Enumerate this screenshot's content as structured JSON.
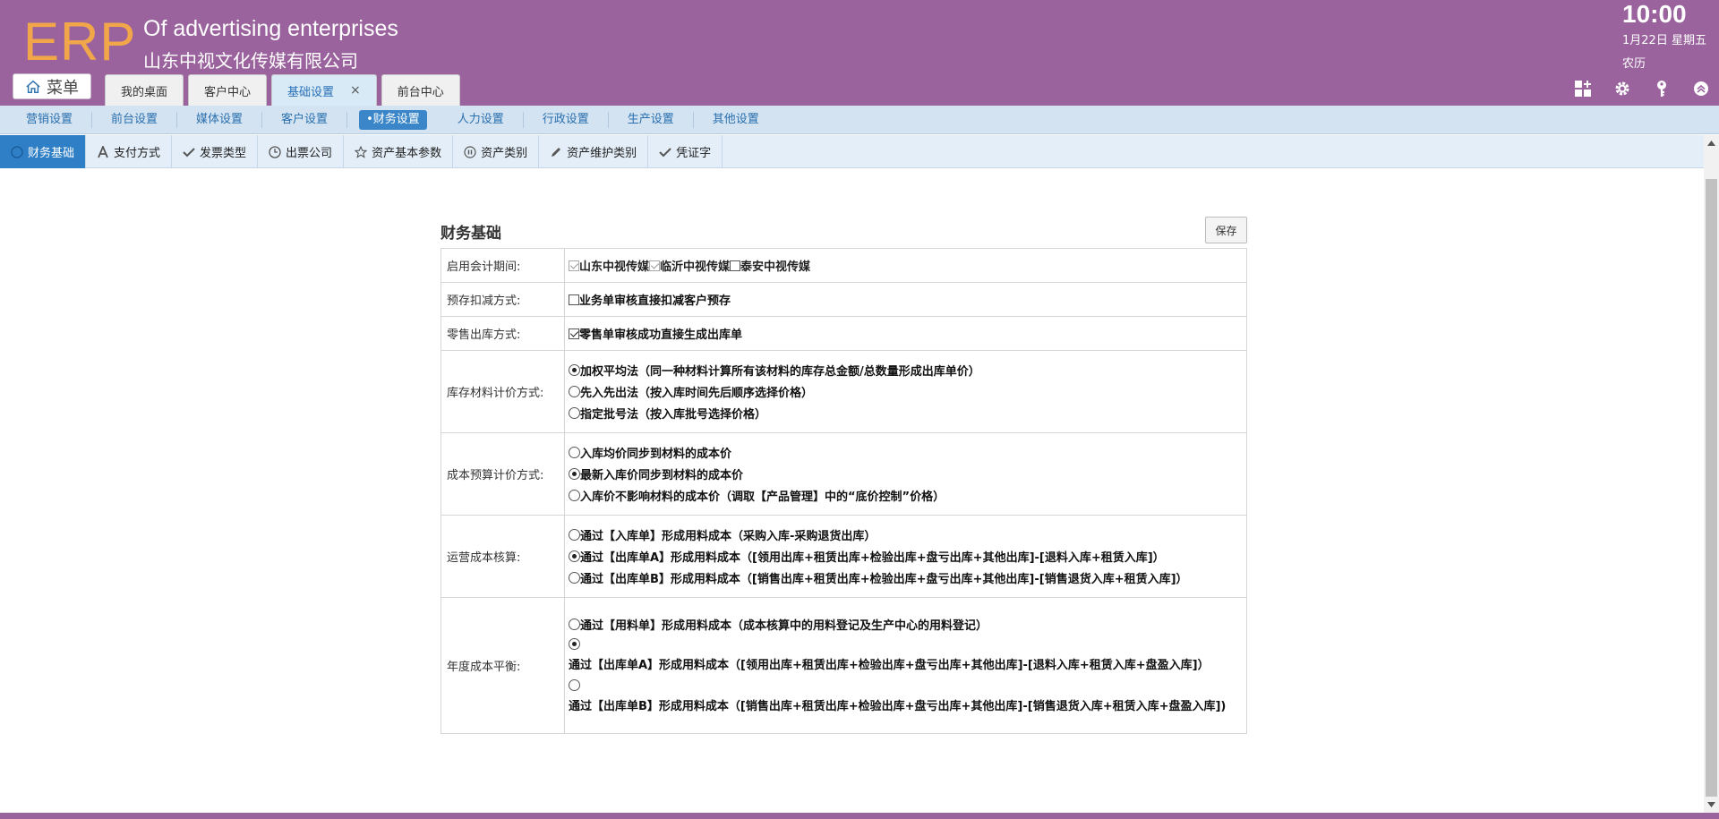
{
  "header": {
    "logo": "ERP",
    "company_en": "Of advertising enterprises",
    "company_cn": "山东中视文化传媒有限公司",
    "time": "10:00",
    "date": "1月22日 星期五",
    "lunar": "农历",
    "menu_label": "菜单",
    "bg_color": "#9a639d",
    "logo_color": "#f2a64a"
  },
  "top_tabs": [
    {
      "label": "我的桌面"
    },
    {
      "label": "客户中心"
    },
    {
      "label": "基础设置",
      "close": "×"
    },
    {
      "label": "前台中心"
    }
  ],
  "header_icons": [
    "apps-icon",
    "gear-icon",
    "key-icon",
    "collapse-icon"
  ],
  "nav2": [
    {
      "label": "营销设置"
    },
    {
      "label": "前台设置"
    },
    {
      "label": "媒体设置"
    },
    {
      "label": "客户设置"
    },
    {
      "label": "•财务设置"
    },
    {
      "label": "人力设置"
    },
    {
      "label": "行政设置"
    },
    {
      "label": "生产设置"
    },
    {
      "label": "其他设置"
    }
  ],
  "nav3": [
    {
      "label": "财务基础",
      "icon": "circle-icon"
    },
    {
      "label": "支付方式",
      "icon": "font-icon"
    },
    {
      "label": "发票类型",
      "icon": "check-icon"
    },
    {
      "label": "出票公司",
      "icon": "clock-icon"
    },
    {
      "label": "资产基本参数",
      "icon": "star-icon"
    },
    {
      "label": "资产类别",
      "icon": "pause-icon"
    },
    {
      "label": "资产维护类别",
      "icon": "pencil-icon"
    },
    {
      "label": "凭证字",
      "icon": "check-icon"
    }
  ],
  "panel": {
    "title": "财务基础",
    "save_label": "保存"
  },
  "rows": {
    "period": {
      "label": "启用会计期间:",
      "options": [
        {
          "text": "山东中视传媒",
          "checked": true,
          "disabled": true
        },
        {
          "text": "临沂中视传媒",
          "checked": true,
          "disabled": true
        },
        {
          "text": "泰安中视传媒",
          "checked": false,
          "disabled": false
        }
      ]
    },
    "prestore": {
      "label": "预存扣减方式:",
      "option": {
        "text": "业务单审核直接扣减客户预存",
        "checked": false
      }
    },
    "retail": {
      "label": "零售出库方式:",
      "option": {
        "text": "零售单审核成功直接生成出库单",
        "checked": true
      }
    },
    "inventory": {
      "label": "库存材料计价方式:",
      "options": [
        {
          "text": "加权平均法（同一种材料计算所有该材料的库存总金额/总数量形成出库单价）",
          "selected": true
        },
        {
          "text": "先入先出法（按入库时间先后顺序选择价格）",
          "selected": false
        },
        {
          "text": "指定批号法（按入库批号选择价格）",
          "selected": false
        }
      ]
    },
    "cost_budget": {
      "label": "成本预算计价方式:",
      "options": [
        {
          "text": "入库均价同步到材料的成本价",
          "selected": false
        },
        {
          "text": "最新入库价同步到材料的成本价",
          "selected": true
        },
        {
          "text": "入库价不影响材料的成本价（调取【产品管理】中的“底价控制”价格）",
          "selected": false
        }
      ]
    },
    "operating": {
      "label": "运营成本核算:",
      "options": [
        {
          "text": "通过【入库单】形成用料成本（采购入库-采购退货出库）",
          "selected": false
        },
        {
          "text": "通过【出库单A】形成用料成本（[领用出库+租赁出库+检验出库+盘亏出库+其他出库]-[退料入库+租赁入库]）",
          "selected": true
        },
        {
          "text": "通过【出库单B】形成用料成本（[销售出库+租赁出库+检验出库+盘亏出库+其他出库]-[销售退货入库+租赁入库]）",
          "selected": false
        }
      ]
    },
    "annual": {
      "label": "年度成本平衡:",
      "options": [
        {
          "text": "通过【用料单】形成用料成本（成本核算中的用料登记及生产中心的用料登记）",
          "selected": false
        },
        {
          "text": "通过【出库单A】形成用料成本（[领用出库+租赁出库+检验出库+盘亏出库+其他出库]-[退料入库+租赁入库+盘盈入库]）",
          "selected": true
        },
        {
          "text": "通过【出库单B】形成用料成本（[销售出库+租赁出库+检验出库+盘亏出库+其他出库]-[销售退货入库+租赁入库+盘盈入库])",
          "selected": false
        }
      ]
    }
  }
}
